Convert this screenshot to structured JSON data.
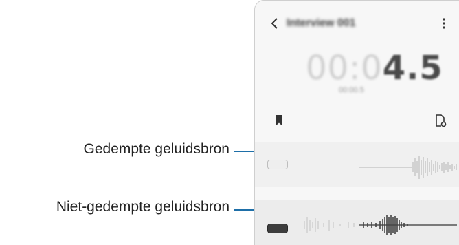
{
  "callouts": {
    "muted_label": "Gedempte geluidsbron",
    "unmuted_label": "Niet-gedempte geluidsbron",
    "line_color": "#1e6fa8"
  },
  "recorder": {
    "title": "Interview 001",
    "timer_dim": "00:0",
    "timer_bright": "4.5",
    "subtime": "00:00.5",
    "icons": {
      "back": "chevron-left-icon",
      "more": "more-vertical-icon",
      "bookmark": "bookmark-icon",
      "document": "document-check-icon"
    },
    "tracks": [
      {
        "state": "muted",
        "toggle_color": "#eeeeee"
      },
      {
        "state": "unmuted",
        "toggle_color": "#3d3d3d"
      }
    ],
    "playhead_color": "#f08a8a"
  }
}
